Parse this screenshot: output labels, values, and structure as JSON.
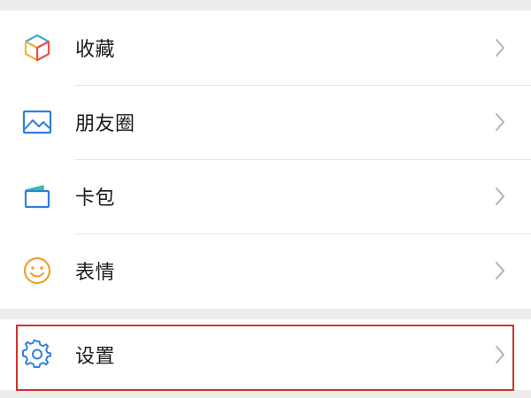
{
  "menu": {
    "items": [
      {
        "label": "收藏",
        "icon": "favorites-cube-icon"
      },
      {
        "label": "朋友圈",
        "icon": "moments-picture-icon"
      },
      {
        "label": "卡包",
        "icon": "card-wallet-icon"
      },
      {
        "label": "表情",
        "icon": "sticker-smiley-icon"
      }
    ],
    "settings": {
      "label": "设置",
      "icon": "settings-gear-icon"
    }
  },
  "colors": {
    "icon_blue": "#2f7fe0",
    "icon_orange": "#f0a030",
    "highlight": "#d3312c",
    "chevron": "#b2b2b2",
    "separator": "#e6e6e6",
    "page_background": "#ededed"
  }
}
